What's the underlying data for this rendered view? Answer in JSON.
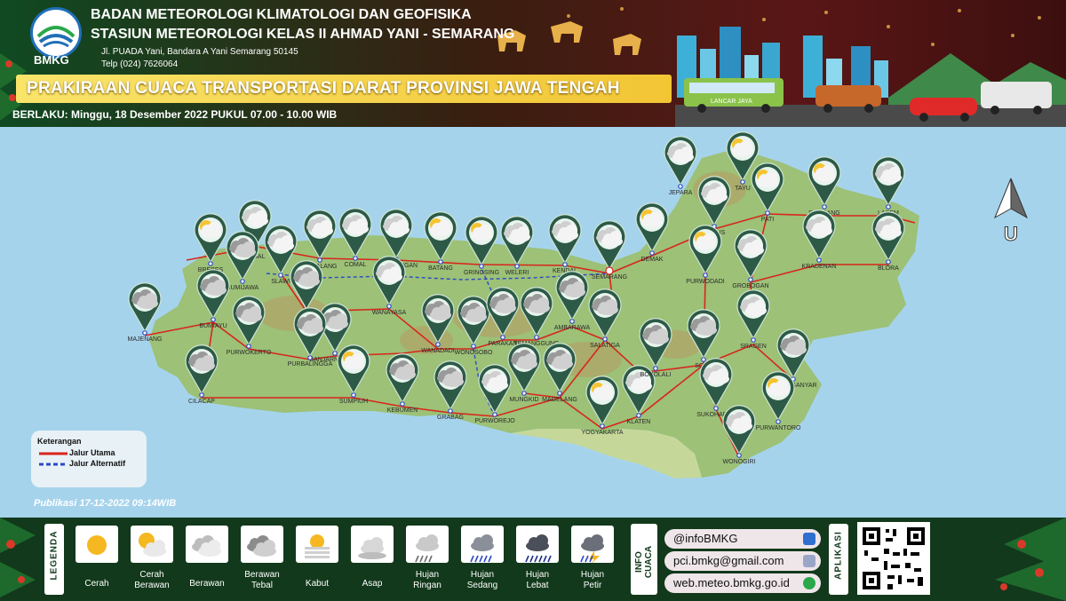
{
  "header": {
    "logo_text": "BMKG",
    "agency": "BADAN METEOROLOGI KLIMATOLOGI DAN GEOFISIKA",
    "station": "STASIUN METEOROLOGI KELAS II AHMAD YANI - SEMARANG",
    "address": "Jl. PUADA Yani, Bandara A Yani Semarang 50145",
    "phone": "Telp (024) 7626064",
    "title": "PRAKIRAAN CUACA TRANSPORTASI DARAT PROVINSI JAWA TENGAH",
    "valid": "BERLAKU: Minggu, 18 Desember 2022  PUKUL 07.00 - 10.00 WIB",
    "bus_label": "LANCAR JAYA"
  },
  "map": {
    "north_label": "U",
    "keterangan_title": "Keterangan",
    "jalur_utama": "Jalur Utama",
    "jalur_alternatif": "Jalur Alternatif",
    "publikasi": "Publikasi 17-12-2022 09:14WIB",
    "colors": {
      "sea": "#a6d3ec",
      "land": "#9cc177",
      "main_road": "#d8261c",
      "alt_road": "#2b49c8",
      "pin": "#2c5a46"
    },
    "cities": [
      {
        "name": "BREBES",
        "weather": "cerah-berawan"
      },
      {
        "name": "TEGAL",
        "weather": "berawan"
      },
      {
        "name": "SLAWI",
        "weather": "berawan"
      },
      {
        "name": "PEMALANG",
        "weather": "berawan"
      },
      {
        "name": "COMAL",
        "weather": "berawan"
      },
      {
        "name": "PEKALONGAN",
        "weather": "berawan"
      },
      {
        "name": "BATANG",
        "weather": "cerah-berawan"
      },
      {
        "name": "GRINGSING",
        "weather": "cerah-berawan"
      },
      {
        "name": "WELERI",
        "weather": "berawan"
      },
      {
        "name": "KENDAL",
        "weather": "berawan"
      },
      {
        "name": "SEMARANG",
        "weather": "berawan"
      },
      {
        "name": "DEMAK",
        "weather": "cerah-berawan"
      },
      {
        "name": "JEPARA",
        "weather": "berawan"
      },
      {
        "name": "TAYU",
        "weather": "cerah-berawan"
      },
      {
        "name": "KUDUS",
        "weather": "berawan"
      },
      {
        "name": "PATI",
        "weather": "cerah-berawan"
      },
      {
        "name": "REMBANG",
        "weather": "cerah-berawan"
      },
      {
        "name": "LASEM",
        "weather": "berawan"
      },
      {
        "name": "BLORA",
        "weather": "berawan"
      },
      {
        "name": "KRADENAN",
        "weather": "berawan"
      },
      {
        "name": "GROBOGAN",
        "weather": "berawan"
      },
      {
        "name": "PURWODADI",
        "weather": "cerah-berawan"
      },
      {
        "name": "MAJENANG",
        "weather": "berawan-tebal"
      },
      {
        "name": "BUMIJAWA",
        "weather": "berawan-tebal"
      },
      {
        "name": "BUMIAYU",
        "weather": "berawan-tebal"
      },
      {
        "name": "MOGA",
        "weather": "berawan-tebal"
      },
      {
        "name": "WANAYASA",
        "weather": "berawan"
      },
      {
        "name": "PURWOKERTO",
        "weather": "berawan-tebal"
      },
      {
        "name": "BANJARNEGARA",
        "weather": "berawan-tebal"
      },
      {
        "name": "PURBALINGGA",
        "weather": "berawan-tebal"
      },
      {
        "name": "CILACAP",
        "weather": "berawan-tebal"
      },
      {
        "name": "SUMPIUH",
        "weather": "cerah-berawan"
      },
      {
        "name": "KEBUMEN",
        "weather": "berawan-tebal"
      },
      {
        "name": "WANADADI",
        "weather": "berawan-tebal"
      },
      {
        "name": "WONOSOBO",
        "weather": "berawan-tebal"
      },
      {
        "name": "GRABAG",
        "weather": "berawan-tebal"
      },
      {
        "name": "PARAKAN",
        "weather": "berawan-tebal"
      },
      {
        "name": "TEMANGGUNG",
        "weather": "berawan-tebal"
      },
      {
        "name": "AMBARAWA",
        "weather": "berawan-tebal"
      },
      {
        "name": "PURWOREJO",
        "weather": "berawan"
      },
      {
        "name": "MUNGKID",
        "weather": "berawan-tebal"
      },
      {
        "name": "MAGELANG",
        "weather": "berawan-tebal"
      },
      {
        "name": "SALATIGA",
        "weather": "berawan-tebal"
      },
      {
        "name": "YOGYAKARTA",
        "weather": "cerah-berawan"
      },
      {
        "name": "KLATEN",
        "weather": "berawan"
      },
      {
        "name": "BOYOLALI",
        "weather": "berawan-tebal"
      },
      {
        "name": "SOLO",
        "weather": "berawan-tebal"
      },
      {
        "name": "SRAGEN",
        "weather": "berawan"
      },
      {
        "name": "KARANGANYAR",
        "weather": "berawan-tebal"
      },
      {
        "name": "SUKOHARJO",
        "weather": "berawan"
      },
      {
        "name": "PURWANTORO",
        "weather": "cerah-berawan"
      },
      {
        "name": "WONOGIRI",
        "weather": "berawan"
      }
    ]
  },
  "legend": {
    "side_label": "LEGENDA",
    "items": [
      {
        "label": "Cerah",
        "icon": "sun-icon"
      },
      {
        "label": "Cerah\nBerawan",
        "icon": "sun-cloud-icon"
      },
      {
        "label": "Berawan",
        "icon": "cloud-icon"
      },
      {
        "label": "Berawan\nTebal",
        "icon": "thick-cloud-icon"
      },
      {
        "label": "Kabut",
        "icon": "fog-icon"
      },
      {
        "label": "Asap",
        "icon": "smoke-icon"
      },
      {
        "label": "Hujan\nRingan",
        "icon": "light-rain-icon"
      },
      {
        "label": "Hujan\nSedang",
        "icon": "moderate-rain-icon"
      },
      {
        "label": "Hujan\nLebat",
        "icon": "heavy-rain-icon"
      },
      {
        "label": "Hujan\nPetir",
        "icon": "thunderstorm-icon"
      }
    ]
  },
  "info": {
    "side_label": "INFO\nCUACA",
    "contacts": [
      {
        "text": "@infoBMKG",
        "icon": "twitter-icon"
      },
      {
        "text": "pci.bmkg@gmail.com",
        "icon": "email-icon"
      },
      {
        "text": "web.meteo.bmkg.go.id",
        "icon": "web-icon"
      }
    ]
  },
  "app": {
    "side_label": "APLIKASI",
    "qr": "qr-code"
  }
}
